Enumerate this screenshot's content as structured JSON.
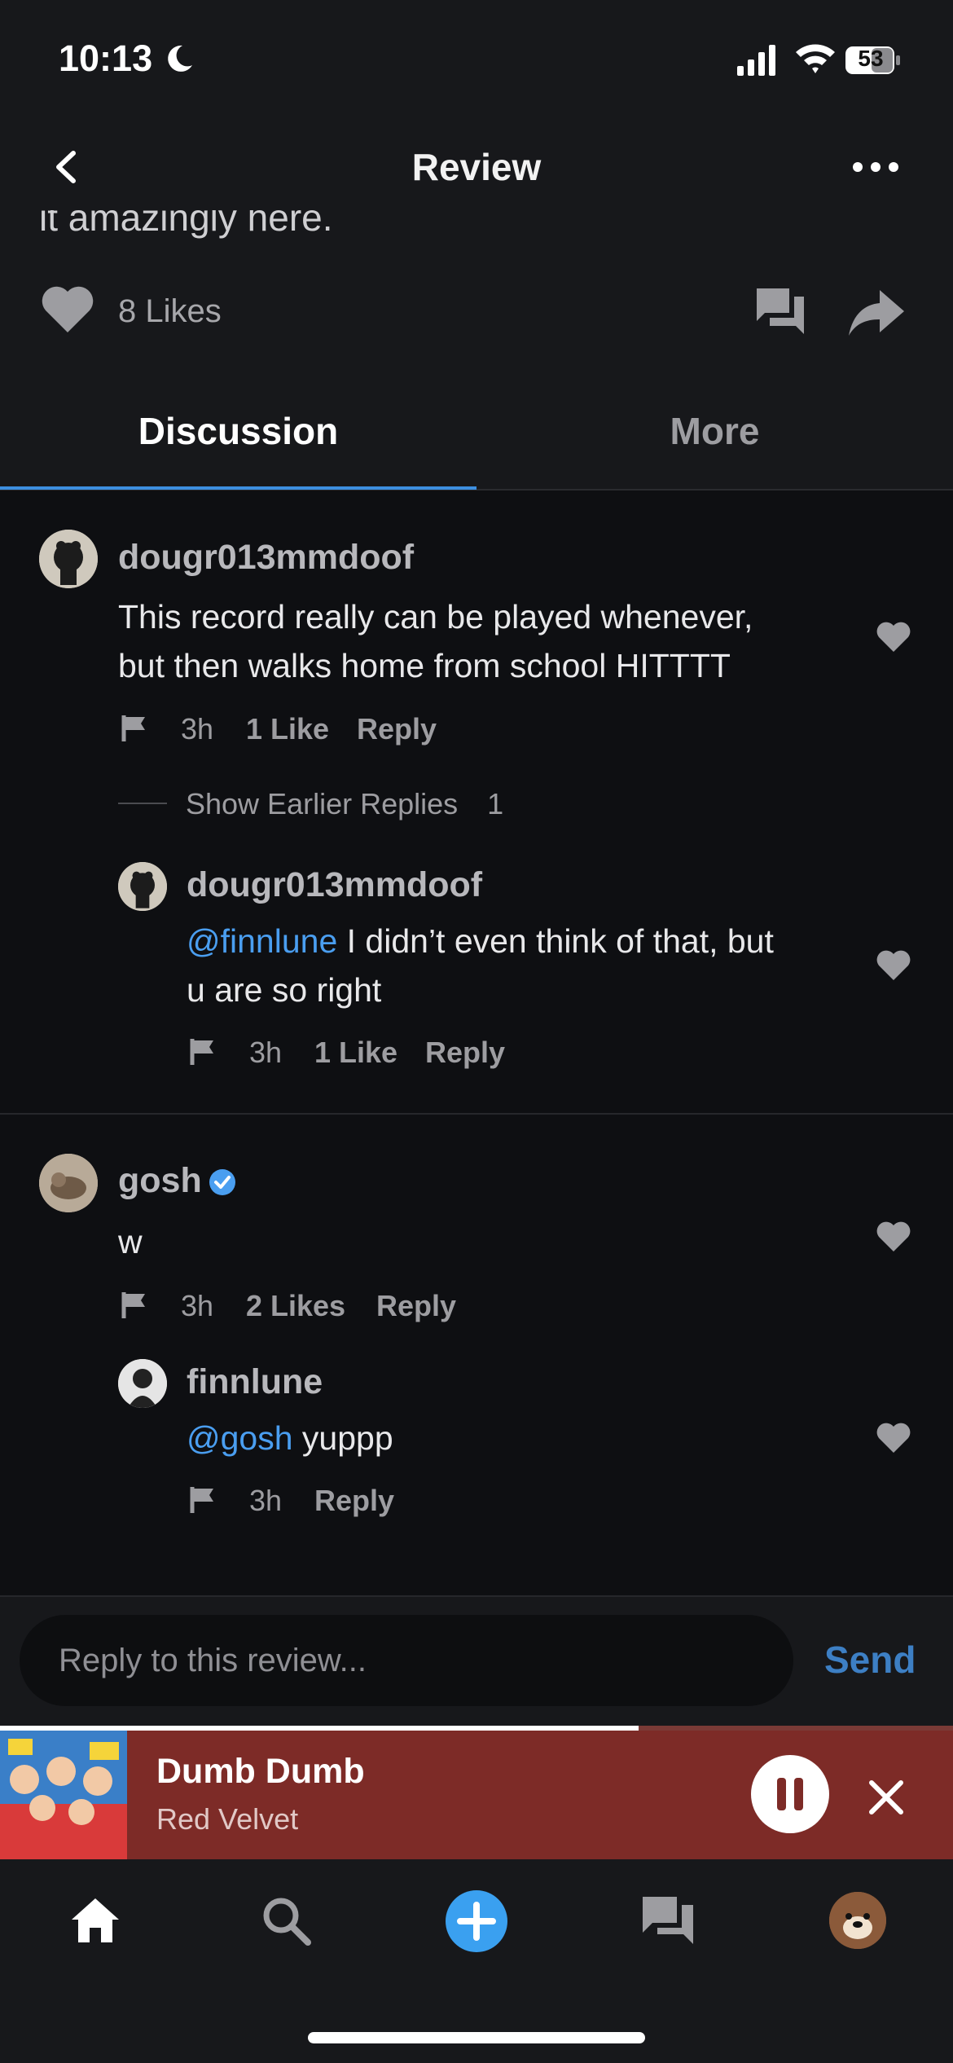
{
  "status_bar": {
    "time": "10:13",
    "battery": "53"
  },
  "header": {
    "title": "Review"
  },
  "review": {
    "clipped_text": "it amazingly here.",
    "likes": "8 Likes"
  },
  "tabs": [
    {
      "label": "Discussion",
      "active": true
    },
    {
      "label": "More",
      "active": false
    }
  ],
  "comments": [
    {
      "user": "dougr013mmdoof",
      "text_line1": "This record really can be played whenever,",
      "text_line2": "but then walks home from school HITTTT",
      "time": "3h",
      "likes": "1 Like",
      "reply": "Reply",
      "show_earlier": "Show Earlier Replies",
      "show_earlier_count": "1",
      "replies": [
        {
          "user": "dougr013mmdoof",
          "mention": "@finnlune",
          "text_line1": " I didn’t even think of that, but",
          "text_line2": "u are so right",
          "time": "3h",
          "likes": "1 Like",
          "reply": "Reply"
        }
      ]
    },
    {
      "user": "gosh",
      "verified": true,
      "text": "w",
      "time": "3h",
      "likes": "2 Likes",
      "reply": "Reply",
      "replies": [
        {
          "user": "finnlune",
          "mention": "@gosh",
          "text": " yuppp",
          "time": "3h",
          "reply": "Reply"
        }
      ]
    }
  ],
  "reply_box": {
    "placeholder": "Reply to this review...",
    "send": "Send"
  },
  "now_playing": {
    "title": "Dumb Dumb",
    "artist": "Red Velvet",
    "progress": 0.67
  },
  "bottom_nav": {
    "items": [
      "home-icon",
      "search-icon",
      "add-icon",
      "chat-icon",
      "profile-avatar"
    ]
  },
  "colors": {
    "accent": "#3d8fe0",
    "mention": "#4a9ef0",
    "now_playing_bg": "#7d2b27",
    "add_button": "#3aa0f0"
  }
}
